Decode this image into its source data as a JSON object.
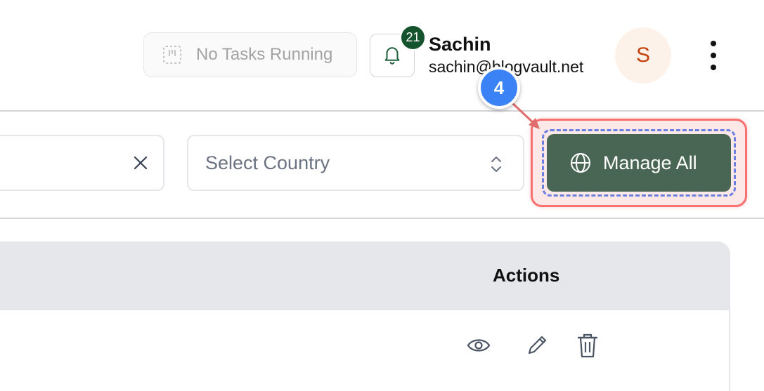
{
  "header": {
    "tasks_label": "No Tasks Running",
    "notification_count": "21",
    "user": {
      "name": "Sachin",
      "email": "sachin@blogvault.net",
      "avatar_initial": "S"
    }
  },
  "filters": {
    "country_placeholder": "Select Country",
    "manage_all_label": "Manage All"
  },
  "annotation": {
    "step_number": "4",
    "highlight_color": "#f87171",
    "marker_color": "#3b82f6"
  },
  "table": {
    "columns": [
      {
        "label": "Actions"
      }
    ],
    "row_actions": [
      "eye-icon",
      "pencil-icon",
      "trash-icon"
    ]
  },
  "colors": {
    "primary_button": "#486653",
    "badge": "#14532d",
    "avatar_bg": "#fdf2e9",
    "avatar_text": "#c2410c"
  }
}
